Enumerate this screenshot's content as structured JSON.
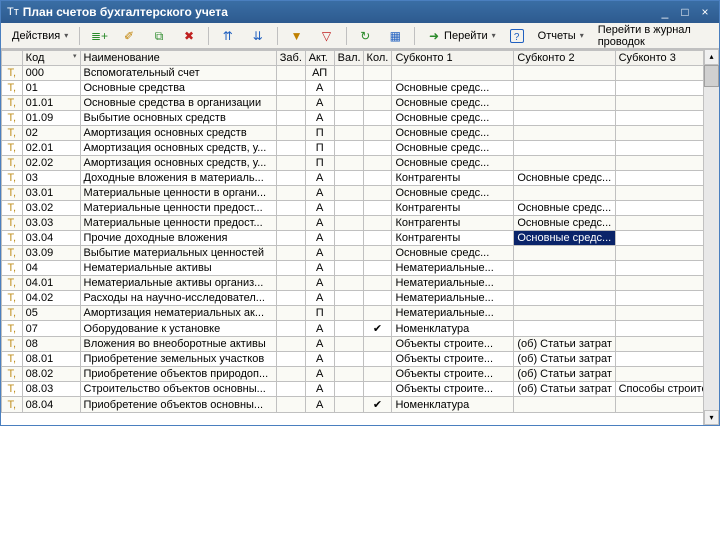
{
  "title": "План счетов бухгалтерского учета",
  "toolbar": {
    "actions": "Действия",
    "goto": "Перейти",
    "reports": "Отчеты",
    "journal": "Перейти в журнал проводок"
  },
  "columns": {
    "code": "Код",
    "name": "Наименование",
    "zab": "Заб.",
    "akt": "Акт.",
    "val": "Вал.",
    "kol": "Кол.",
    "s1": "Субконто 1",
    "s2": "Субконто 2",
    "s3": "Субконто 3"
  },
  "rows": [
    {
      "code": "000",
      "name": "Вспомогательный счет",
      "akt": "АП",
      "s1": "",
      "s2": "",
      "s3": ""
    },
    {
      "code": "01",
      "name": "Основные средства",
      "akt": "А",
      "s1": "Основные средс...",
      "s2": "",
      "s3": ""
    },
    {
      "code": "01.01",
      "name": "Основные средства в организации",
      "akt": "А",
      "s1": "Основные средс...",
      "s2": "",
      "s3": ""
    },
    {
      "code": "01.09",
      "name": "Выбытие основных средств",
      "akt": "А",
      "s1": "Основные средс...",
      "s2": "",
      "s3": ""
    },
    {
      "code": "02",
      "name": "Амортизация основных средств",
      "akt": "П",
      "s1": "Основные средс...",
      "s2": "",
      "s3": ""
    },
    {
      "code": "02.01",
      "name": "Амортизация основных средств, у...",
      "akt": "П",
      "s1": "Основные средс...",
      "s2": "",
      "s3": ""
    },
    {
      "code": "02.02",
      "name": "Амортизация основных средств, у...",
      "akt": "П",
      "s1": "Основные средс...",
      "s2": "",
      "s3": ""
    },
    {
      "code": "03",
      "name": "Доходные вложения в материаль...",
      "akt": "А",
      "s1": "Контрагенты",
      "s2": "Основные средс...",
      "s3": ""
    },
    {
      "code": "03.01",
      "name": "Материальные ценности в органи...",
      "akt": "А",
      "s1": "Основные средс...",
      "s2": "",
      "s3": ""
    },
    {
      "code": "03.02",
      "name": "Материальные ценности предост...",
      "akt": "А",
      "s1": "Контрагенты",
      "s2": "Основные средс...",
      "s3": ""
    },
    {
      "code": "03.03",
      "name": "Материальные ценности предост...",
      "akt": "А",
      "s1": "Контрагенты",
      "s2": "Основные средс...",
      "s3": ""
    },
    {
      "code": "03.04",
      "name": "Прочие доходные вложения",
      "akt": "А",
      "s1": "Контрагенты",
      "s2": "Основные средс...",
      "s3": "",
      "sel2": true
    },
    {
      "code": "03.09",
      "name": "Выбытие материальных ценностей",
      "akt": "А",
      "s1": "Основные средс...",
      "s2": "",
      "s3": ""
    },
    {
      "code": "04",
      "name": "Нематериальные активы",
      "akt": "А",
      "s1": "Нематериальные...",
      "s2": "",
      "s3": ""
    },
    {
      "code": "04.01",
      "name": "Нематериальные активы организ...",
      "akt": "А",
      "s1": "Нематериальные...",
      "s2": "",
      "s3": ""
    },
    {
      "code": "04.02",
      "name": "Расходы на научно-исследовател...",
      "akt": "А",
      "s1": "Нематериальные...",
      "s2": "",
      "s3": ""
    },
    {
      "code": "05",
      "name": "Амортизация нематериальных ак...",
      "akt": "П",
      "s1": "Нематериальные...",
      "s2": "",
      "s3": ""
    },
    {
      "code": "07",
      "name": "Оборудование к установке",
      "akt": "А",
      "kol": "✔",
      "s1": "Номенклатура",
      "s2": "",
      "s3": ""
    },
    {
      "code": "08",
      "name": "Вложения во внеоборотные активы",
      "akt": "А",
      "s1": "Объекты строите...",
      "s2": "(об) Статьи затрат",
      "s3": ""
    },
    {
      "code": "08.01",
      "name": "Приобретение земельных участков",
      "akt": "А",
      "s1": "Объекты строите...",
      "s2": "(об) Статьи затрат",
      "s3": ""
    },
    {
      "code": "08.02",
      "name": "Приобретение объектов природоп...",
      "akt": "А",
      "s1": "Объекты строите...",
      "s2": "(об) Статьи затрат",
      "s3": ""
    },
    {
      "code": "08.03",
      "name": "Строительство объектов основны...",
      "akt": "А",
      "s1": "Объекты строите...",
      "s2": "(об) Статьи затрат",
      "s3": "Способы строите..."
    },
    {
      "code": "08.04",
      "name": "Приобретение объектов основны...",
      "akt": "А",
      "kol": "✔",
      "s1": "Номенклатура",
      "s2": "",
      "s3": ""
    }
  ]
}
